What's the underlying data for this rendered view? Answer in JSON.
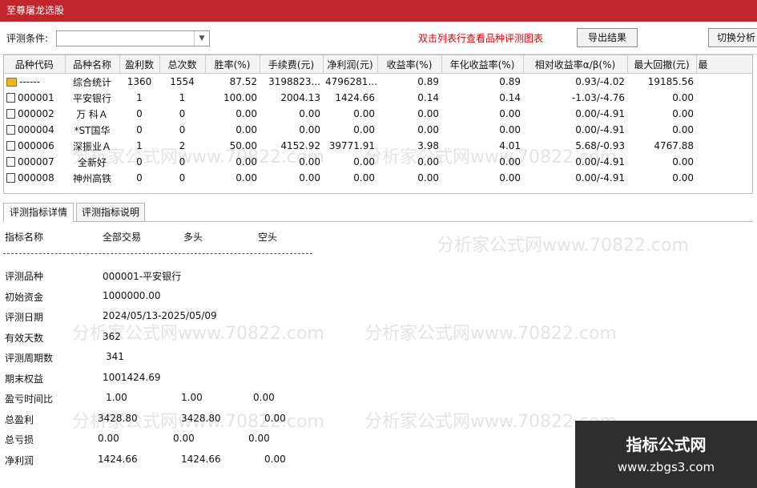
{
  "window": {
    "title": "至尊屠龙选股"
  },
  "toolbar": {
    "condition_label": "评测条件:",
    "condition_value": "",
    "hint": "双击列表行查看品种评测图表",
    "export_label": "导出结果",
    "switch_label": "切换分析"
  },
  "table": {
    "columns": [
      "品种代码",
      "品种名称",
      "盈利数",
      "总次数",
      "胜率(%)",
      "手续费(元)",
      "净利润(元)",
      "收益率(%)",
      "年化收益率(%)",
      "相对收益率α/β(%)",
      "最大回撤(元)",
      "最"
    ],
    "rows": [
      {
        "code": "------",
        "name": "综合统计",
        "wins": "1360",
        "total": "1554",
        "winrate": "87.52",
        "fee": "3198823...",
        "profit": "4796281...",
        "ret": "0.89",
        "annual": "0.89",
        "rel": "0.93/-4.02",
        "dd": "19185.56"
      },
      {
        "code": "000001",
        "name": "平安银行",
        "wins": "1",
        "total": "1",
        "winrate": "100.00",
        "fee": "2004.13",
        "profit": "1424.66",
        "ret": "0.14",
        "annual": "0.14",
        "rel": "-1.03/-4.76",
        "dd": "0.00"
      },
      {
        "code": "000002",
        "name": "万 科Ａ",
        "wins": "0",
        "total": "0",
        "winrate": "0.00",
        "fee": "0.00",
        "profit": "0.00",
        "ret": "0.00",
        "annual": "0.00",
        "rel": "0.00/-4.91",
        "dd": "0.00"
      },
      {
        "code": "000004",
        "name": "*ST国华",
        "wins": "0",
        "total": "0",
        "winrate": "0.00",
        "fee": "0.00",
        "profit": "0.00",
        "ret": "0.00",
        "annual": "0.00",
        "rel": "0.00/-4.91",
        "dd": "0.00"
      },
      {
        "code": "000006",
        "name": "深振业Ａ",
        "wins": "1",
        "total": "2",
        "winrate": "50.00",
        "fee": "4152.92",
        "profit": "39771.91",
        "ret": "3.98",
        "annual": "4.01",
        "rel": "5.68/-0.93",
        "dd": "4767.88"
      },
      {
        "code": "000007",
        "name": "全新好",
        "wins": "0",
        "total": "0",
        "winrate": "0.00",
        "fee": "0.00",
        "profit": "0.00",
        "ret": "0.00",
        "annual": "0.00",
        "rel": "0.00/-4.91",
        "dd": "0.00"
      },
      {
        "code": "000008",
        "name": "神州高铁",
        "wins": "0",
        "total": "0",
        "winrate": "0.00",
        "fee": "0.00",
        "profit": "0.00",
        "ret": "0.00",
        "annual": "0.00",
        "rel": "0.00/-4.91",
        "dd": "0.00"
      }
    ]
  },
  "tabs": [
    "评测指标详情",
    "评测指标说明"
  ],
  "detail": {
    "header": [
      "指标名称",
      "全部交易",
      "多头",
      "空头"
    ],
    "product_label": "评测品种",
    "product_value": "000001-平安银行",
    "capital_label": "初始资金",
    "capital_value": "1000000.00",
    "date_label": "评测日期",
    "date_value": "2024/05/13-2025/05/09",
    "days_label": "有效天数",
    "days_value": "362",
    "periods_label": "评测周期数",
    "periods_value": "341",
    "equity_label": "期末权益",
    "equity_value": "1001424.69",
    "ratio_label": "盈亏时间比",
    "ratio_all": "1.00",
    "ratio_long": "1.00",
    "ratio_short": "0.00",
    "gross_profit_label": "总盈利",
    "gross_profit_all": "3428.80",
    "gross_profit_long": "3428.80",
    "gross_profit_short": "0.00",
    "gross_loss_label": "总亏损",
    "gross_loss_all": "0.00",
    "gross_loss_long": "0.00",
    "gross_loss_short": "0.00",
    "net_label": "净利润",
    "net_all": "1424.66",
    "net_long": "1424.66",
    "net_short": "0.00"
  },
  "watermark": {
    "text": "分析家公式网www.70822.com"
  },
  "brand": {
    "title": "指标公式网",
    "url": "www.zbgs3.com"
  },
  "colors": {
    "titlebar": "#c0262b",
    "hint": "#e00000",
    "brand_bg": "#2e2e2e"
  }
}
